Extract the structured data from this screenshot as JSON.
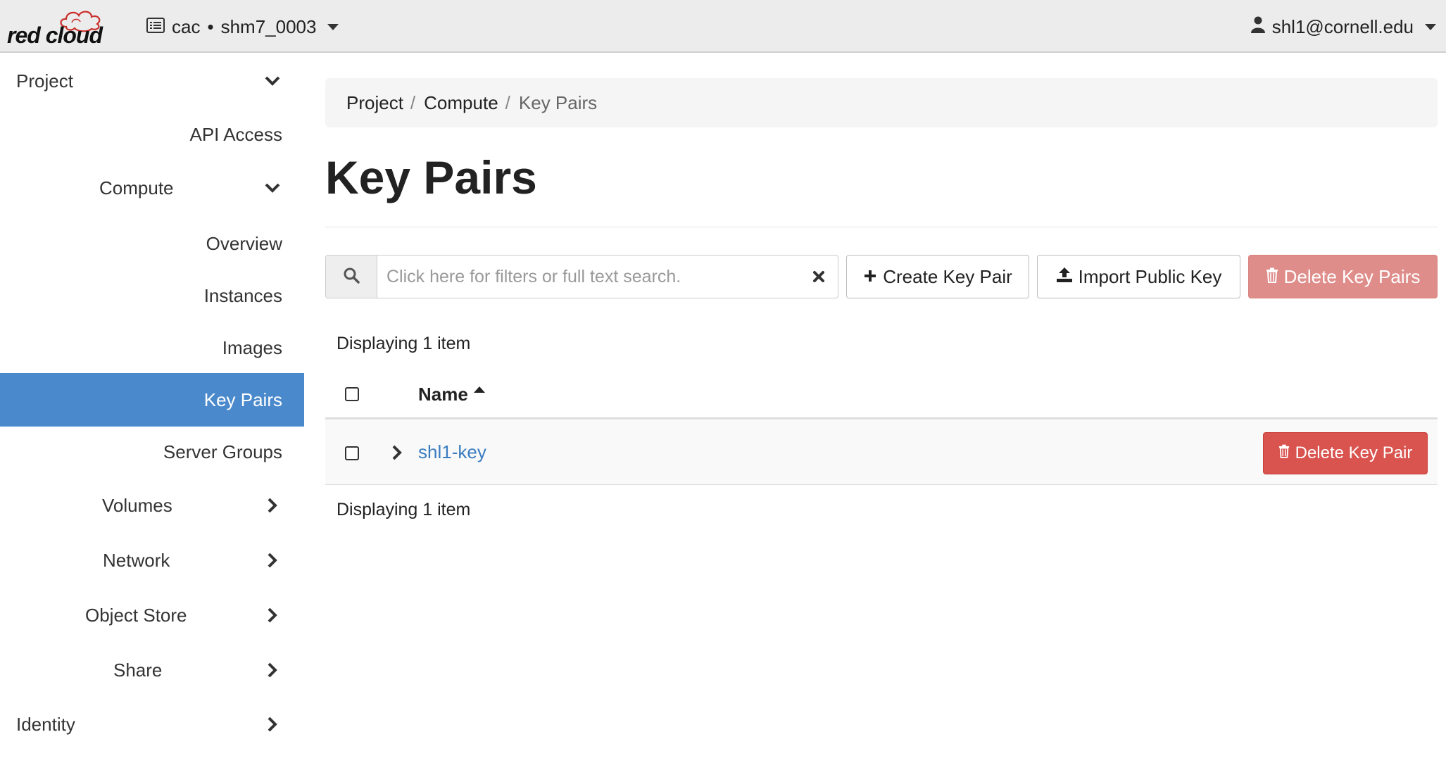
{
  "brand": {
    "logo_text": "red cloud"
  },
  "header": {
    "project_domain": "cac",
    "project_sep": "•",
    "project_name": "shm7_0003",
    "user": "shl1@cornell.edu"
  },
  "sidebar": {
    "items": [
      {
        "label": "Project",
        "chevron": "down"
      },
      {
        "label": "API Access",
        "chevron": "none"
      },
      {
        "label": "Compute",
        "chevron": "down"
      },
      {
        "label": "Overview",
        "chevron": "none"
      },
      {
        "label": "Instances",
        "chevron": "none"
      },
      {
        "label": "Images",
        "chevron": "none"
      },
      {
        "label": "Key Pairs",
        "chevron": "none",
        "active": true
      },
      {
        "label": "Server Groups",
        "chevron": "none"
      },
      {
        "label": "Volumes",
        "chevron": "right"
      },
      {
        "label": "Network",
        "chevron": "right"
      },
      {
        "label": "Object Store",
        "chevron": "right"
      },
      {
        "label": "Share",
        "chevron": "right"
      },
      {
        "label": "Identity",
        "chevron": "right"
      }
    ]
  },
  "breadcrumb": {
    "items": [
      "Project",
      "Compute",
      "Key Pairs"
    ],
    "separator": "/"
  },
  "page": {
    "title": "Key Pairs"
  },
  "toolbar": {
    "search_placeholder": "Click here for filters or full text search.",
    "search_value": "",
    "create_label": "Create Key Pair",
    "import_label": "Import Public Key",
    "delete_all_label": "Delete Key Pairs"
  },
  "table": {
    "count_top": "Displaying 1 item",
    "count_bottom": "Displaying 1 item",
    "columns": [
      "Name"
    ],
    "rows": [
      {
        "name": "shl1-key",
        "action_label": "Delete Key Pair"
      }
    ]
  },
  "colors": {
    "active_nav": "#4a89cc",
    "danger": "#d9534f",
    "danger_disabled": "#df8d8a",
    "link": "#3a7dc0"
  }
}
